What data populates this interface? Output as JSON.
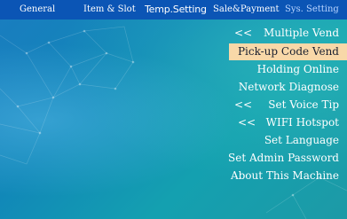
{
  "tabs": [
    {
      "label": "General"
    },
    {
      "label": "Item & Slot"
    },
    {
      "label": "Temp.Setting"
    },
    {
      "label": "Sale&Payment"
    },
    {
      "label": "Sys. Setting",
      "active": true
    }
  ],
  "menu": {
    "items": [
      {
        "label": "Multiple Vend",
        "prefix": "<<"
      },
      {
        "label": "Pick-up Code Vend",
        "selected": true
      },
      {
        "label": "Holding Online"
      },
      {
        "label": "Network Diagnose"
      },
      {
        "label": "Set Voice Tip",
        "prefix": "<<"
      },
      {
        "label": "WIFI Hotspot",
        "prefix": "<<"
      },
      {
        "label": "Set Language"
      },
      {
        "label": "Set Admin Password"
      },
      {
        "label": "About This Machine"
      }
    ]
  },
  "colors": {
    "tabbar_bg": "#0b55b5",
    "selected_bg": "#f8d8a8",
    "active_tab_text": "#b8d4ff"
  }
}
